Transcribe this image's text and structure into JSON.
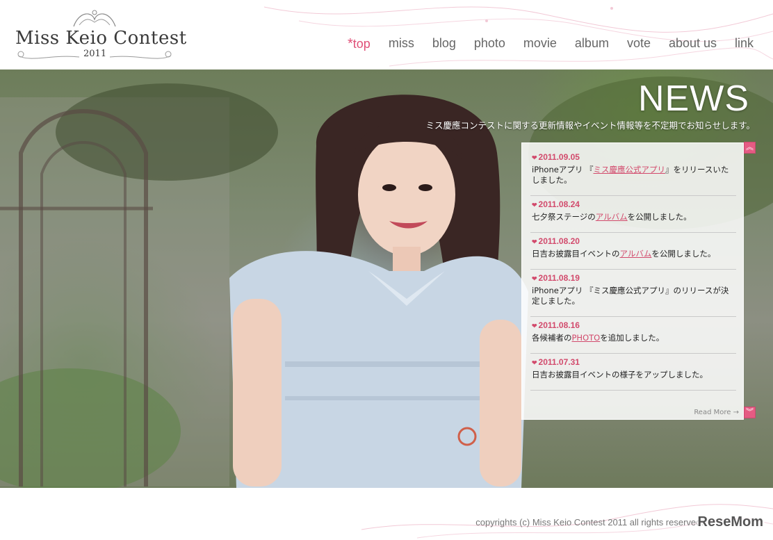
{
  "logo": {
    "title": "Miss Keio Contest",
    "year": "2011"
  },
  "nav": {
    "items": [
      {
        "label": "top",
        "active": true
      },
      {
        "label": "miss"
      },
      {
        "label": "blog"
      },
      {
        "label": "photo"
      },
      {
        "label": "movie"
      },
      {
        "label": "album"
      },
      {
        "label": "vote"
      },
      {
        "label": "about us"
      },
      {
        "label": "link"
      }
    ]
  },
  "news": {
    "title": "NEWS",
    "subtitle": "ミス慶應コンテストに関する更新情報やイベント情報等を不定期でお知らせします。",
    "items": [
      {
        "date": "2011.09.05",
        "pre": "iPhoneアプリ 『",
        "link": "ミス慶應公式アプリ",
        "post": "』をリリースいたしました。"
      },
      {
        "date": "2011.08.24",
        "pre": "七夕祭ステージの",
        "link": "アルバム",
        "post": "を公開しました。"
      },
      {
        "date": "2011.08.20",
        "pre": "日吉お披露目イベントの",
        "link": "アルバム",
        "post": "を公開しました。"
      },
      {
        "date": "2011.08.19",
        "pre": "iPhoneアプリ 『ミス慶應公式アプリ』のリリースが決定しました。",
        "link": "",
        "post": ""
      },
      {
        "date": "2011.08.16",
        "pre": "各候補者の",
        "link": "PHOTO",
        "post": "を追加しました。"
      },
      {
        "date": "2011.07.31",
        "pre": "日吉お披露目イベントの様子をアップしました。",
        "link": "",
        "post": ""
      }
    ],
    "read_more": "Read More",
    "heart_icon": "heart-icon",
    "accent_color": "#d24a6c"
  },
  "footer": {
    "copyright": "copyrights (c) Miss Keio Contest 2011 all rights reserved.",
    "watermark": "ReseMom"
  },
  "colors": {
    "accent": "#e05078",
    "nav_text": "#666666"
  }
}
